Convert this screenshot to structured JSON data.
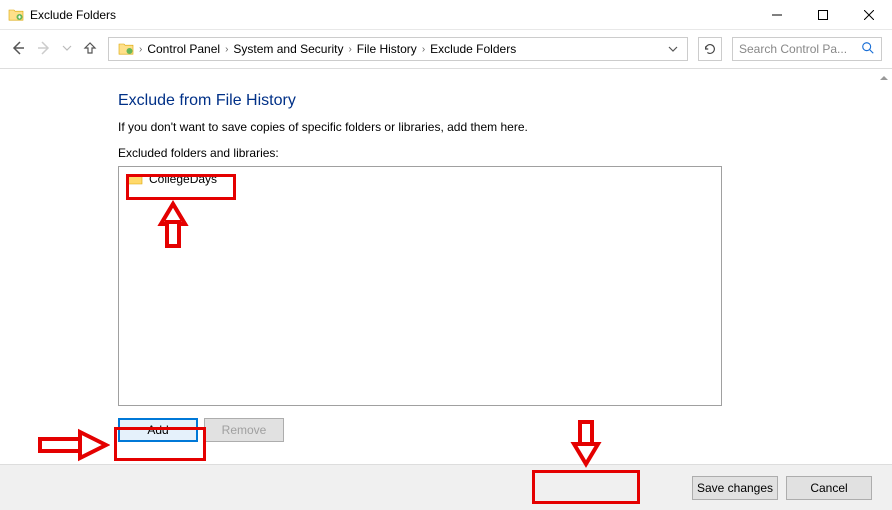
{
  "window": {
    "title": "Exclude Folders"
  },
  "breadcrumb": {
    "items": [
      "Control Panel",
      "System and Security",
      "File History",
      "Exclude Folders"
    ]
  },
  "search": {
    "placeholder": "Search Control Pa..."
  },
  "page": {
    "heading": "Exclude from File History",
    "description": "If you don't want to save copies of specific folders or libraries, add them here.",
    "list_label": "Excluded folders and libraries:"
  },
  "excluded_items": [
    {
      "name": "CollegeDays"
    }
  ],
  "buttons": {
    "add": "Add",
    "remove": "Remove",
    "save": "Save changes",
    "cancel": "Cancel"
  }
}
